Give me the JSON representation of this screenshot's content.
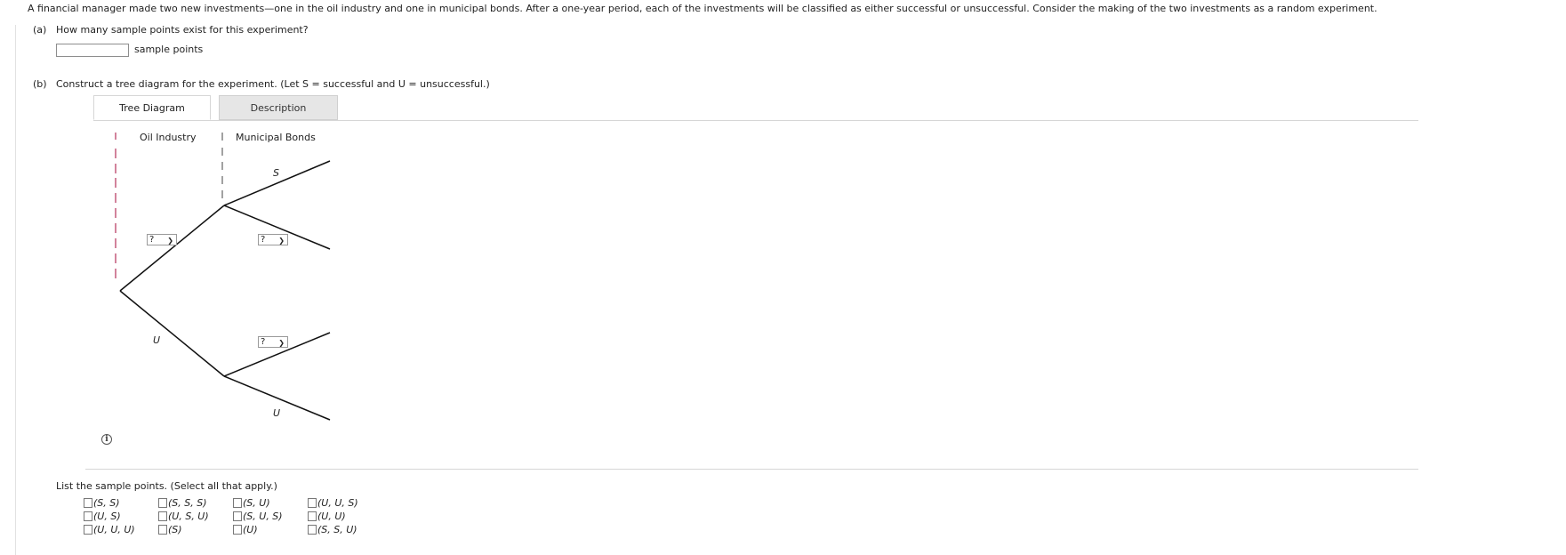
{
  "question": {
    "intro": "A financial manager made two new investments—one in the oil industry and one in municipal bonds. After a one-year period, each of the investments will be classified as either successful or unsuccessful. Consider the making of the two investments as a random experiment."
  },
  "part_a": {
    "label": "(a)",
    "prompt": "How many sample points exist for this experiment?",
    "input_value": "",
    "unit": "sample points"
  },
  "part_b": {
    "label": "(b)",
    "prompt": "Construct a tree diagram for the experiment. (Let S = successful and U = unsuccessful.)",
    "tabs": [
      "Tree Diagram",
      "Description"
    ],
    "tree": {
      "col1": "Oil Industry",
      "col2": "Municipal Bonds",
      "labels": {
        "top_top": "S",
        "bottom": "U",
        "bottom_bottom": "U"
      },
      "dropdown_value": "?"
    },
    "list_prompt": "List the sample points. (Select all that apply.)",
    "options": [
      "(S, S)",
      "(S, S, S)",
      "(S, U)",
      "(U, U, S)",
      "(U, S)",
      "(U, S, U)",
      "(S, U, S)",
      "(U, U)",
      "(U, U, U)",
      "(S)",
      "(U)",
      "(S, S, U)"
    ]
  }
}
